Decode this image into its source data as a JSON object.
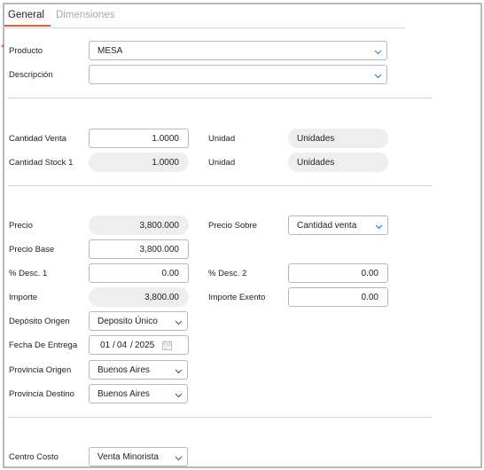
{
  "tabs": [
    {
      "label": "General"
    },
    {
      "label": "Dimensiones"
    }
  ],
  "required_mark": "*",
  "producto": {
    "label": "Producto",
    "value": "MESA"
  },
  "descripcion": {
    "label": "Descripción",
    "value": ""
  },
  "cantidad_venta": {
    "label": "Cantidad Venta",
    "value": "1.0000",
    "unit_label": "Unidad",
    "unit_value": "Unidades"
  },
  "cantidad_stock": {
    "label": "Cantidad Stock 1",
    "value": "1.0000",
    "unit_label": "Unidad",
    "unit_value": "Unidades"
  },
  "precio": {
    "label": "Precio",
    "value": "3,800.000"
  },
  "precio_sobre": {
    "label": "Precio Sobre",
    "value": "Cantidad venta"
  },
  "precio_base": {
    "label": "Precio Base",
    "value": "3,800.000"
  },
  "desc1": {
    "label": "% Desc. 1",
    "value": "0.00"
  },
  "desc2": {
    "label": "% Desc. 2",
    "value": "0.00"
  },
  "importe": {
    "label": "Importe",
    "value": "3,800.00"
  },
  "importe_exento": {
    "label": "Importe Exento",
    "value": "0.00"
  },
  "deposito_origen": {
    "label": "Depósito Origen",
    "value": "Deposito Único"
  },
  "fecha_entrega": {
    "label": "Fecha De Entrega",
    "day": "01",
    "month": "04",
    "year": "2025",
    "separator": "/"
  },
  "provincia_origen": {
    "label": "Provincia Origen",
    "value": "Buenos Aires"
  },
  "provincia_destino": {
    "label": "Provincia Destino",
    "value": "Buenos Aires"
  },
  "centro_costo": {
    "label": "Centro Costo",
    "value": "Venta Minorista"
  },
  "colors": {
    "accent": "#e25a3f",
    "chevron": "#3a7bd5",
    "readonly_bg": "#eeeeee"
  },
  "icons": {
    "dropdown": "chevron-down-icon",
    "calendar": "calendar-icon"
  }
}
